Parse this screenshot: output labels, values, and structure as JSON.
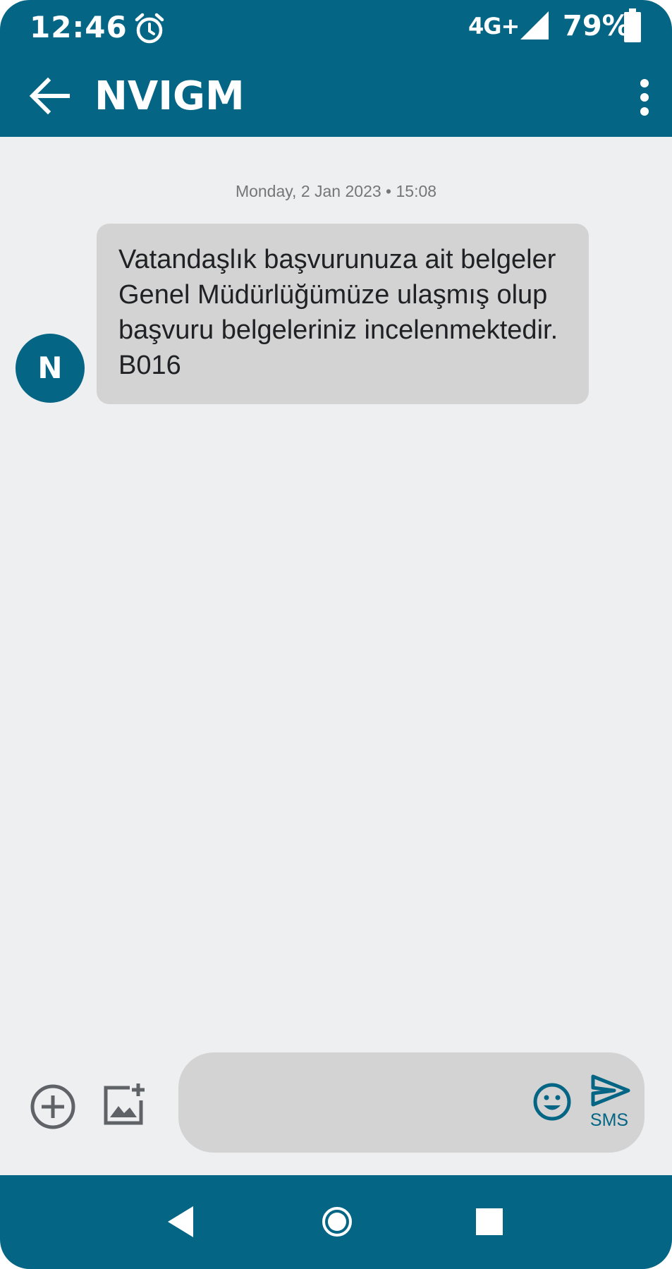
{
  "status_bar": {
    "time": "12:46",
    "network": "4G+",
    "battery": "79%",
    "icons": [
      "alarm-icon",
      "signal-icon",
      "battery-icon"
    ]
  },
  "app_bar": {
    "title": "NVIGM",
    "icons": [
      "back-arrow-icon",
      "more-vert-icon"
    ]
  },
  "conversation": {
    "date": "Monday, 2 Jan 2023 • 15:08",
    "messages": [
      {
        "sender_initial": "N",
        "text": "Vatandaşlık başvurunuza ait belgeler Genel Müdürlüğümüze ulaşmış olup başvuru belgeleriniz incelenmektedir. B016"
      }
    ]
  },
  "compose": {
    "value": "",
    "send_label": "SMS",
    "icons": [
      "add-circle-icon",
      "add-image-icon",
      "emoji-icon",
      "send-icon"
    ]
  },
  "nav_bar": {
    "icons": [
      "nav-back-icon",
      "nav-home-icon",
      "nav-recents-icon"
    ]
  },
  "colors": {
    "primary": "#046585",
    "background": "#EEEFF1",
    "bubble": "#D3D3D3",
    "icon_gray": "#5F6368"
  }
}
